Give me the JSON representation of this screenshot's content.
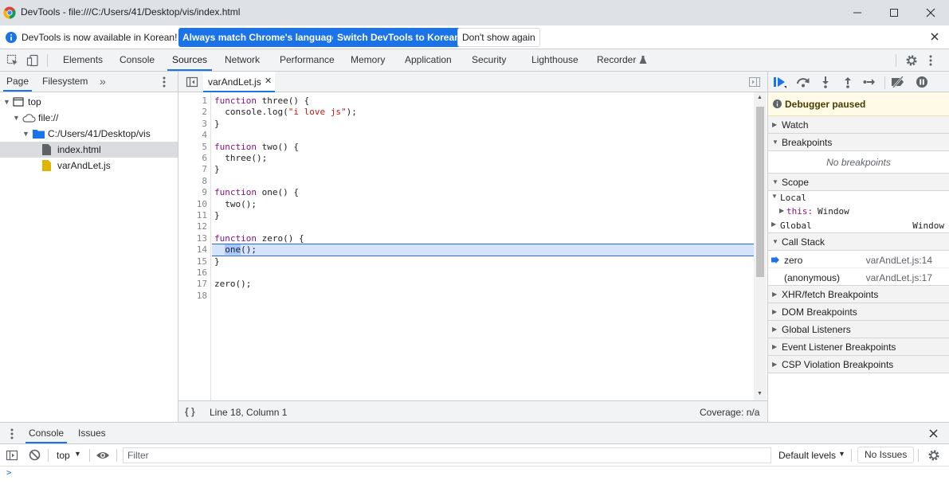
{
  "window": {
    "title": "DevTools - file:///C:/Users/41/Desktop/vis/index.html"
  },
  "infobar": {
    "message": "DevTools is now available in Korean!",
    "btn_match": "Always match Chrome's language",
    "btn_switch": "Switch DevTools to Korean",
    "btn_dismiss": "Don't show again"
  },
  "main_tabs": [
    "Elements",
    "Console",
    "Sources",
    "Network",
    "Performance",
    "Memory",
    "Application",
    "Security",
    "Lighthouse",
    "Recorder"
  ],
  "navigator": {
    "tabs": [
      "Page",
      "Filesystem"
    ],
    "tree": {
      "top": "top",
      "origin": "file://",
      "folder": "C:/Users/41/Desktop/vis",
      "files": [
        "index.html",
        "varAndLet.js"
      ]
    }
  },
  "editor": {
    "file_tab": "varAndLet.js",
    "lines": [
      "function three() {",
      "  console.log(\"i love js\");",
      "}",
      "",
      "function two() {",
      "  three();",
      "}",
      "",
      "function one() {",
      "  two();",
      "}",
      "",
      "function zero() {",
      "  one();",
      "}",
      "",
      "zero();",
      ""
    ],
    "line_numbers": [
      "1",
      "2",
      "3",
      "4",
      "5",
      "6",
      "7",
      "8",
      "9",
      "10",
      "11",
      "12",
      "13",
      "14",
      "15",
      "16",
      "17",
      "18"
    ],
    "paused_line": 14,
    "status_pretty": "{ }",
    "status_position": "Line 18, Column 1",
    "status_coverage": "Coverage: n/a"
  },
  "debugger": {
    "paused_label": "Debugger paused",
    "watch": "Watch",
    "breakpoints": "Breakpoints",
    "no_breakpoints": "No breakpoints",
    "scope": "Scope",
    "local": "Local",
    "this_key": "this:",
    "this_val": "Window",
    "global": "Global",
    "global_val": "Window",
    "call_stack": "Call Stack",
    "frames": [
      {
        "name": "zero",
        "location": "varAndLet.js:14"
      },
      {
        "name": "(anonymous)",
        "location": "varAndLet.js:17"
      }
    ],
    "xhr": "XHR/fetch Breakpoints",
    "dom": "DOM Breakpoints",
    "global_listeners": "Global Listeners",
    "event_listeners": "Event Listener Breakpoints",
    "csp": "CSP Violation Breakpoints"
  },
  "drawer": {
    "tabs": [
      "Console",
      "Issues"
    ],
    "context": "top",
    "filter_placeholder": "Filter",
    "levels": "Default levels",
    "issues": "No Issues",
    "prompt": ">"
  },
  "colors": {
    "accent": "#1a73e8",
    "keyword": "#881280",
    "string": "#c41a16",
    "paused_bg": "#fffbe6"
  }
}
